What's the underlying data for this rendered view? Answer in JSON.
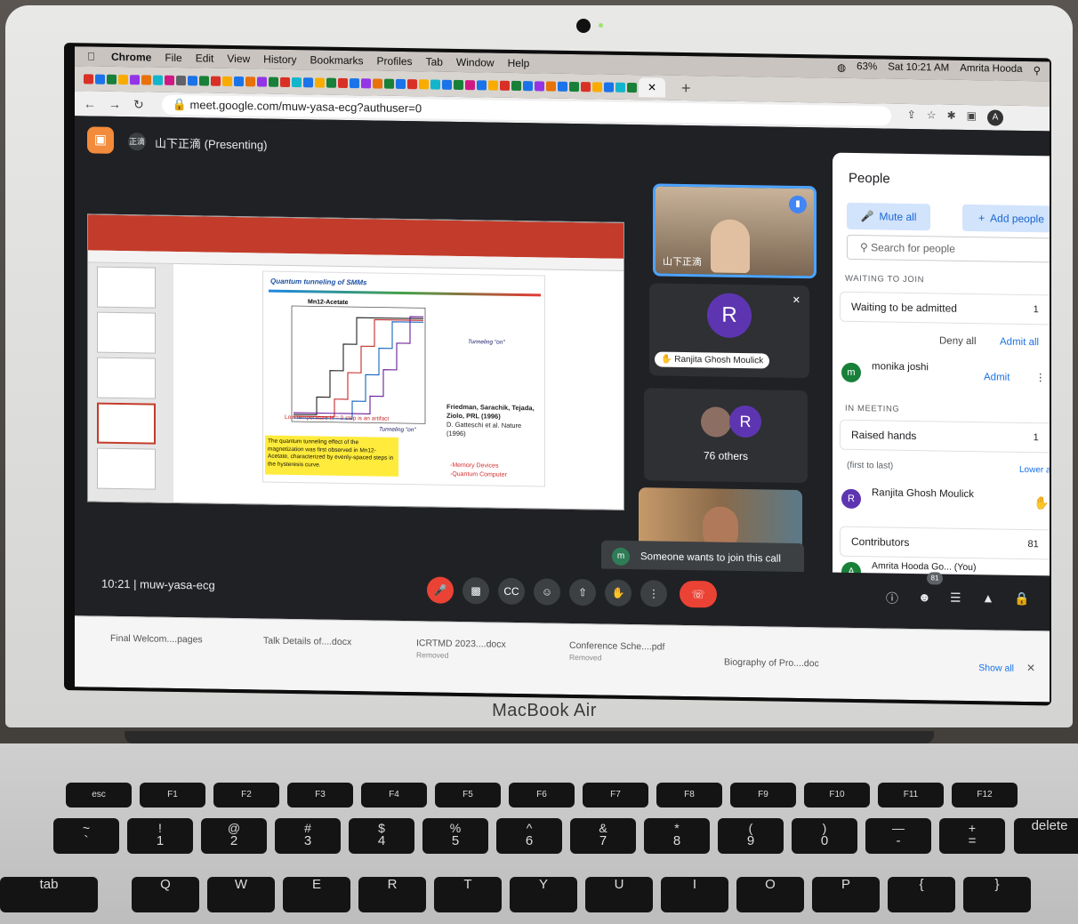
{
  "mac_menu": {
    "items": [
      "Chrome",
      "File",
      "Edit",
      "View",
      "History",
      "Bookmarks",
      "Profiles",
      "Tab",
      "Window",
      "Help"
    ],
    "battery": "63%",
    "clock": "Sat 10:21 AM",
    "user": "Amrita Hooda"
  },
  "browser": {
    "url": "meet.google.com/muw-yasa-ecg?authuser=0",
    "profile_initial": "A",
    "favicon_colors": [
      "#d93025",
      "#1a73e8",
      "#188038",
      "#f9ab00",
      "#9334e6",
      "#e8710a",
      "#12b5cb",
      "#d01884",
      "#5f6368",
      "#1a73e8",
      "#188038",
      "#d93025",
      "#f9ab00",
      "#1a73e8",
      "#e8710a",
      "#9334e6",
      "#188038",
      "#d93025",
      "#12b5cb",
      "#1a73e8",
      "#f9ab00",
      "#188038",
      "#d93025",
      "#1a73e8",
      "#9334e6",
      "#e8710a",
      "#188038",
      "#1a73e8",
      "#d93025",
      "#f9ab00",
      "#12b5cb",
      "#1a73e8",
      "#188038",
      "#d01884",
      "#1a73e8",
      "#f9ab00",
      "#d93025",
      "#188038",
      "#1a73e8",
      "#9334e6",
      "#e8710a",
      "#1a73e8",
      "#188038",
      "#d93025",
      "#f9ab00",
      "#1a73e8",
      "#12b5cb",
      "#188038"
    ]
  },
  "meet": {
    "presenter": "山下正滴 (Presenting)",
    "presenter_initials": "正滴",
    "tile1_name": "山下正滴",
    "tile2_initial": "R",
    "tile2_name": "Ranjita Ghosh Moulick",
    "tile3_initial": "R",
    "tile3_label": "76 others",
    "toast_initial": "m",
    "toast_text": "Someone wants to join this call",
    "meeting_time": "10:21",
    "meeting_code": "muw-yasa-ecg",
    "people_count": "81"
  },
  "slide": {
    "title": "Quantum tunneling of SMMs",
    "molecule": "Mn12-Acetate",
    "tunneling_on_1": "Tunneling \"on\"",
    "tunneling_on_2": "Tunneling \"on\"",
    "low_temp": "Low temperature H = 0 step is an artifact",
    "citation1": "Friedman, Sarachik, Tejada, Ziolo, PRL (1996)",
    "citation2": "D. Gatteschi et al. Nature (1996)",
    "yellow": "The quantum tunneling effect of the magnetization was first observed in Mn12-Acetate, characterized by evenly-spaced steps in the hysteresis curve.",
    "app1": "-Memory Devices",
    "app2": "-Quantum Computer"
  },
  "people_panel": {
    "title": "People",
    "mute_all": "Mute all",
    "add_people": "Add people",
    "search_placeholder": "Search for people",
    "waiting_section": "WAITING TO JOIN",
    "waiting_group": "Waiting to be admitted",
    "waiting_count": "1",
    "deny_all": "Deny all",
    "admit_all": "Admit all",
    "waiting_person_initial": "m",
    "waiting_person": "monika joshi",
    "admit": "Admit",
    "in_meeting_section": "IN MEETING",
    "raised_group": "Raised hands",
    "raised_count": "1",
    "order_note": "(first to last)",
    "lower_all": "Lower all",
    "raised_person_initial": "R",
    "raised_person": "Ranjita Ghosh Moulick",
    "contributors": "Contributors",
    "contributors_count": "81",
    "self_initial": "A",
    "self_name": "Amrita Hooda Go...",
    "self_tag": "(You)"
  },
  "downloads": [
    {
      "name": "Final Welcom....pages",
      "sub": ""
    },
    {
      "name": "Talk Details of....docx",
      "sub": ""
    },
    {
      "name": "ICRTMD 2023....docx",
      "sub": "Removed"
    },
    {
      "name": "Conference Sche....pdf",
      "sub": "Removed"
    },
    {
      "name": "Biography of Pro....doc",
      "sub": ""
    }
  ],
  "show_all": "Show all",
  "laptop_brand": "MacBook Air",
  "keys": {
    "fn_row": [
      "esc",
      "F1",
      "F2",
      "F3",
      "F4",
      "F5",
      "F6",
      "F7",
      "F8",
      "F9",
      "F10",
      "F11",
      "F12"
    ],
    "num_row": [
      [
        "~",
        "`"
      ],
      [
        "!",
        "1"
      ],
      [
        "@",
        "2"
      ],
      [
        "#",
        "3"
      ],
      [
        "$",
        "4"
      ],
      [
        "%",
        "5"
      ],
      [
        "^",
        "6"
      ],
      [
        "&",
        "7"
      ],
      [
        "*",
        "8"
      ],
      [
        "(",
        "9"
      ],
      [
        ")",
        "0"
      ],
      [
        "—",
        "-"
      ],
      [
        "+",
        "="
      ]
    ],
    "delete": "delete",
    "tab": "tab",
    "letters": [
      "Q",
      "W",
      "E",
      "R",
      "T",
      "Y",
      "U",
      "I",
      "O",
      "P",
      "{",
      "}"
    ]
  }
}
